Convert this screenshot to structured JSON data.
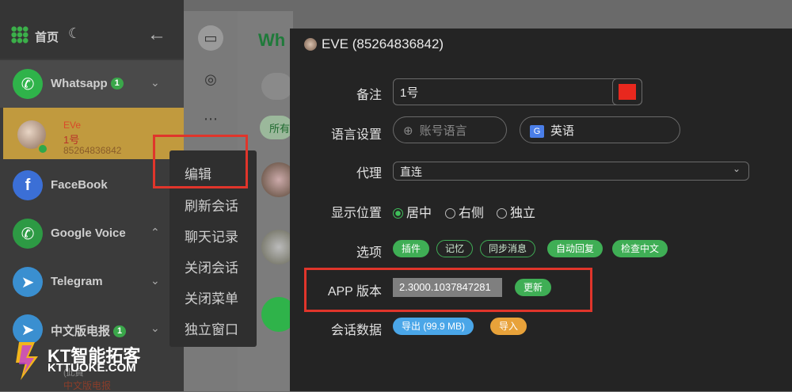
{
  "sidebar": {
    "home_label": "首页",
    "accounts": [
      {
        "name": "Whatsapp",
        "badge": "1",
        "chevron": "⌄"
      },
      {
        "name": "FaceBook",
        "chevron": "⌄"
      },
      {
        "name": "Google Voice",
        "chevron": "⌃"
      },
      {
        "name": "Telegram",
        "chevron": "⌄"
      },
      {
        "name": "中文版电报",
        "badge": "1",
        "chevron": "⌄"
      }
    ],
    "selected_contact": {
      "name": "EVe",
      "note": "1号",
      "phone": "85264836842"
    },
    "bottom_ghost": "(此員",
    "bottom_ghost2": "中文版电报"
  },
  "chat_panel": {
    "header": "Wh",
    "filter": "所有"
  },
  "context_menu": {
    "items": [
      "编辑",
      "刷新会话",
      "聊天记录",
      "关闭会话",
      "关闭菜单",
      "独立窗口"
    ]
  },
  "dialog": {
    "title": "EVE (85264836842)",
    "note_label": "备注",
    "note_value": "1号",
    "note_color": "#e8281e",
    "language_label": "语言设置",
    "language_account_placeholder": "账号语言",
    "language_value": "英语",
    "proxy_label": "代理",
    "proxy_value": "直连",
    "display_label": "显示位置",
    "display_options": [
      "居中",
      "右侧",
      "独立"
    ],
    "display_selected": "居中",
    "options_label": "选项",
    "options": [
      {
        "label": "插件",
        "enabled": true
      },
      {
        "label": "记忆",
        "enabled": false
      },
      {
        "label": "同步消息",
        "enabled": false
      },
      {
        "label": "自动回复",
        "enabled": true
      },
      {
        "label": "检查中文",
        "enabled": true
      }
    ],
    "app_version_label": "APP 版本",
    "app_version_value": "2.3000.1037847281",
    "update_label": "更新",
    "session_data_label": "会话数据",
    "export_label": "导出 (99.9 MB)",
    "import_label": "导入"
  },
  "watermark": {
    "line1": "KT智能拓客",
    "line2": "KTTUOKE.COM"
  },
  "colors": {
    "accent_green": "#3fae55",
    "highlight_red": "#e0352b",
    "selected_row": "#c19a3e"
  }
}
